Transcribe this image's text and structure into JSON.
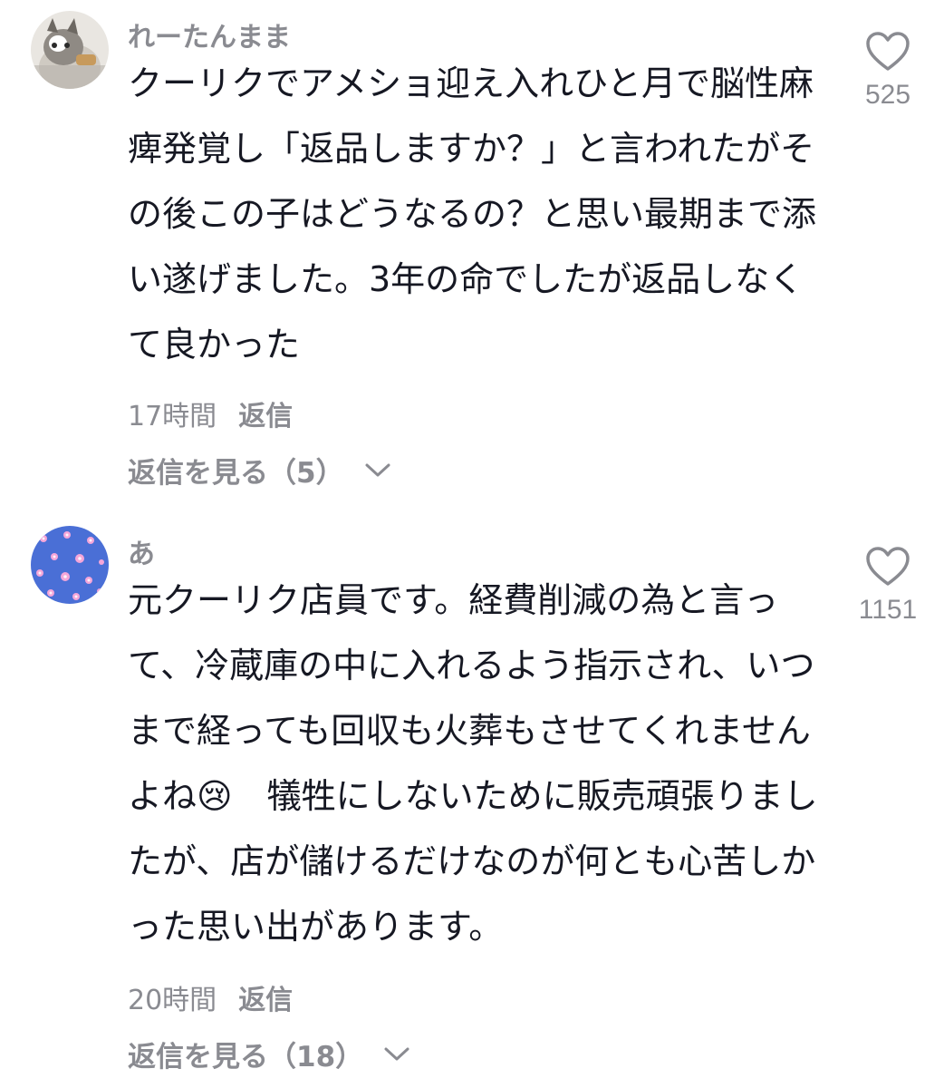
{
  "comments": [
    {
      "username": "れーたんまま",
      "avatar_icon": "cat-photo-avatar",
      "text": "クーリクでアメショ迎え入れひと月で脳性麻痺発覚し「返品しますか？」と言われたがその後この子はどうなるの？と思い最期まで添い遂げました。3年の命でしたが返品しなくて良かった",
      "time": "17時間",
      "reply_label": "返信",
      "view_replies_label": "返信を見る（5）",
      "likes": "525",
      "like_icon": "heart-outline-icon"
    },
    {
      "username": "あ",
      "avatar_icon": "flower-pattern-avatar",
      "text_before_emoji": "元クーリク店員です。経費削減の為と言って、冷蔵庫の中に入れるよう指示され、いつまで経っても回収も火葬もさせてくれませんよね",
      "emoji": "😢",
      "text_after_emoji": "　犠牲にしないために販売頑張りましたが、店が儲けるだけなのが何とも心苦しかった思い出があります。",
      "time": "20時間",
      "reply_label": "返信",
      "view_replies_label": "返信を見る（18）",
      "likes": "1151",
      "like_icon": "heart-outline-icon"
    }
  ],
  "colors": {
    "text_primary": "#161823",
    "text_secondary": "#8a8b91",
    "avatar2_bg": "#4a6fd6",
    "avatar2_flower": "#f4a6d9"
  }
}
